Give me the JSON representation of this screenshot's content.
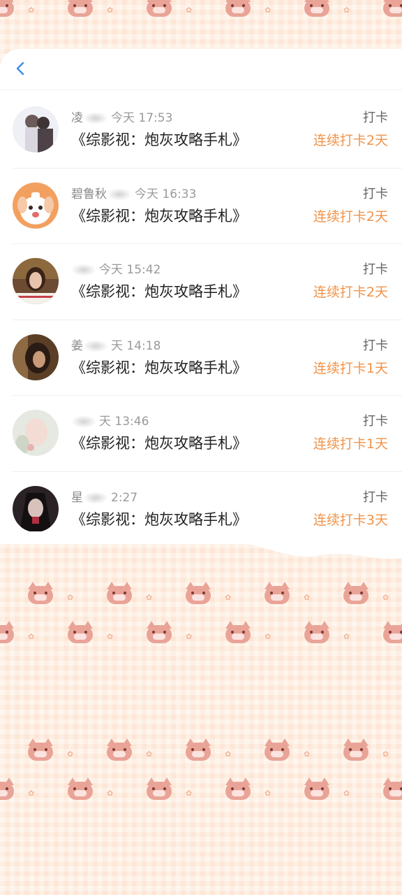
{
  "header": {
    "back_icon": "chevron-left-icon"
  },
  "checkins": [
    {
      "name": "凌",
      "time": "今天 17:53",
      "book_title": "《综影视：炮灰攻略手札》",
      "action": "打卡",
      "streak": "连续打卡2天",
      "avatar": "avatar-illustration"
    },
    {
      "name": "碧鲁秋",
      "time": "今天 16:33",
      "book_title": "《综影视：炮灰攻略手札》",
      "action": "打卡",
      "streak": "连续打卡2天",
      "avatar": "avatar-dog-cartoon"
    },
    {
      "name": "",
      "time": "今天 15:42",
      "book_title": "《综影视：炮灰攻略手札》",
      "action": "打卡",
      "streak": "连续打卡2天",
      "avatar": "avatar-photo-girl"
    },
    {
      "name": "姜",
      "time": "天 14:18",
      "book_title": "《综影视：炮灰攻略手札》",
      "action": "打卡",
      "streak": "连续打卡1天",
      "avatar": "avatar-photo-dark"
    },
    {
      "name": "",
      "time": "天 13:46",
      "book_title": "《综影视：炮灰攻略手札》",
      "action": "打卡",
      "streak": "连续打卡1天",
      "avatar": "avatar-photo-light"
    },
    {
      "name": "星",
      "time": "2:27",
      "book_title": "《综影视：炮灰攻略手札》",
      "action": "打卡",
      "streak": "连续打卡3天",
      "avatar": "avatar-illustration-dark"
    }
  ],
  "colors": {
    "accent": "#f0934a",
    "background": "#fde6d6",
    "pattern_cat": "#e9a497"
  }
}
